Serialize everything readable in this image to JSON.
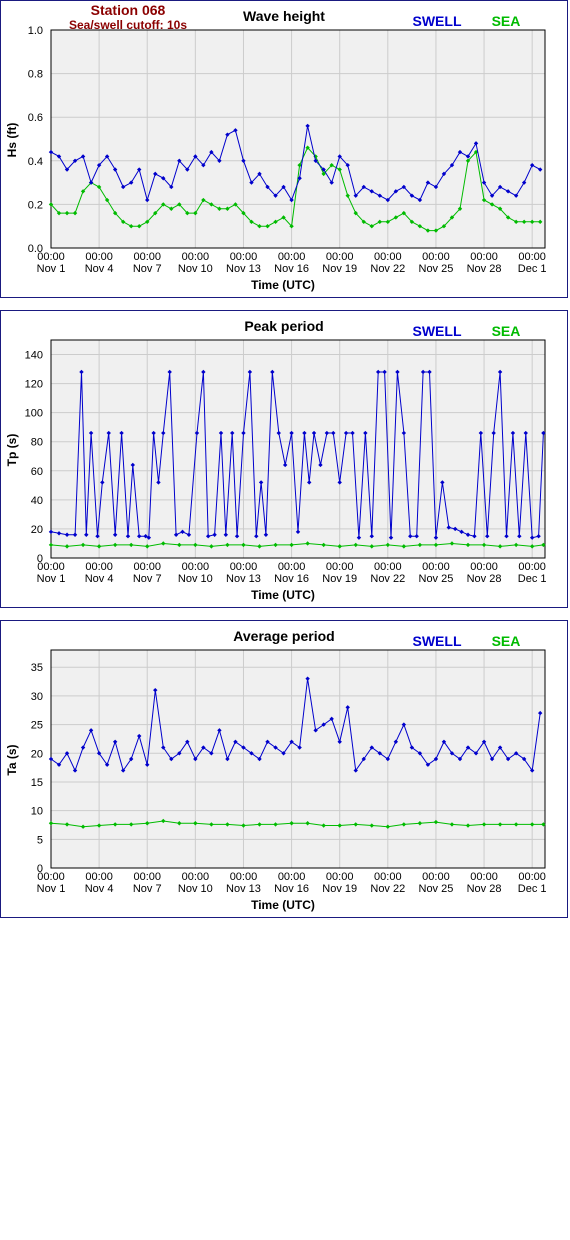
{
  "station": {
    "title": "Station 068",
    "subtitle": "Sea/swell cutoff: 10s"
  },
  "colors": {
    "swell": "#0000cc",
    "sea": "#00bb00",
    "station": "#8b0000",
    "frame": "#1a1a80",
    "plot_bg": "#f0f0f0",
    "grid": "#cccccc"
  },
  "legend": {
    "swell": "SWELL",
    "sea": "SEA"
  },
  "x_ticks": [
    {
      "day": 0,
      "time": "00:00",
      "date": "Nov 1"
    },
    {
      "day": 3,
      "time": "00:00",
      "date": "Nov 4"
    },
    {
      "day": 6,
      "time": "00:00",
      "date": "Nov 7"
    },
    {
      "day": 9,
      "time": "00:00",
      "date": "Nov 10"
    },
    {
      "day": 12,
      "time": "00:00",
      "date": "Nov 13"
    },
    {
      "day": 15,
      "time": "00:00",
      "date": "Nov 16"
    },
    {
      "day": 18,
      "time": "00:00",
      "date": "Nov 19"
    },
    {
      "day": 21,
      "time": "00:00",
      "date": "Nov 22"
    },
    {
      "day": 24,
      "time": "00:00",
      "date": "Nov 25"
    },
    {
      "day": 27,
      "time": "00:00",
      "date": "Nov 28"
    },
    {
      "day": 30,
      "time": "00:00",
      "date": "Dec 1"
    }
  ],
  "chart_data": [
    {
      "type": "line",
      "title": "Wave height",
      "xlabel": "Time (UTC)",
      "ylabel": "Hs (ft)",
      "xlim": [
        0,
        30.8
      ],
      "ylim": [
        0,
        1.0
      ],
      "yticks": [
        "0.0",
        "0.2",
        "0.4",
        "0.6",
        "0.8",
        "1.0"
      ],
      "ytick_values": [
        0,
        0.2,
        0.4,
        0.6,
        0.8,
        1.0
      ],
      "grid": true,
      "legend": "top-right",
      "series": [
        {
          "name": "SWELL",
          "x": [
            0,
            0.5,
            1,
            1.5,
            2,
            2.5,
            3,
            3.5,
            4,
            4.5,
            5,
            5.5,
            6,
            6.5,
            7,
            7.5,
            8,
            8.5,
            9,
            9.5,
            10,
            10.5,
            11,
            11.5,
            12,
            12.5,
            13,
            13.5,
            14,
            14.5,
            15,
            15.5,
            16,
            16.5,
            17,
            17.5,
            18,
            18.5,
            19,
            19.5,
            20,
            20.5,
            21,
            21.5,
            22,
            22.5,
            23,
            23.5,
            24,
            24.5,
            25,
            25.5,
            26,
            26.5,
            27,
            27.5,
            28,
            28.5,
            29,
            29.5,
            30,
            30.5
          ],
          "y": [
            0.44,
            0.42,
            0.36,
            0.4,
            0.42,
            0.3,
            0.38,
            0.42,
            0.36,
            0.28,
            0.3,
            0.36,
            0.22,
            0.34,
            0.32,
            0.28,
            0.4,
            0.36,
            0.42,
            0.38,
            0.44,
            0.4,
            0.52,
            0.54,
            0.4,
            0.3,
            0.34,
            0.28,
            0.24,
            0.28,
            0.22,
            0.32,
            0.56,
            0.4,
            0.36,
            0.3,
            0.42,
            0.38,
            0.24,
            0.28,
            0.26,
            0.24,
            0.22,
            0.26,
            0.28,
            0.24,
            0.22,
            0.3,
            0.28,
            0.34,
            0.38,
            0.44,
            0.42,
            0.48,
            0.3,
            0.24,
            0.28,
            0.26,
            0.24,
            0.3,
            0.38,
            0.36
          ]
        },
        {
          "name": "SEA",
          "x": [
            0,
            0.5,
            1,
            1.5,
            2,
            2.5,
            3,
            3.5,
            4,
            4.5,
            5,
            5.5,
            6,
            6.5,
            7,
            7.5,
            8,
            8.5,
            9,
            9.5,
            10,
            10.5,
            11,
            11.5,
            12,
            12.5,
            13,
            13.5,
            14,
            14.5,
            15,
            15.5,
            16,
            16.5,
            17,
            17.5,
            18,
            18.5,
            19,
            19.5,
            20,
            20.5,
            21,
            21.5,
            22,
            22.5,
            23,
            23.5,
            24,
            24.5,
            25,
            25.5,
            26,
            26.5,
            27,
            27.5,
            28,
            28.5,
            29,
            29.5,
            30,
            30.5
          ],
          "y": [
            0.2,
            0.16,
            0.16,
            0.16,
            0.26,
            0.3,
            0.28,
            0.22,
            0.16,
            0.12,
            0.1,
            0.1,
            0.12,
            0.16,
            0.2,
            0.18,
            0.2,
            0.16,
            0.16,
            0.22,
            0.2,
            0.18,
            0.18,
            0.2,
            0.16,
            0.12,
            0.1,
            0.1,
            0.12,
            0.14,
            0.1,
            0.38,
            0.46,
            0.42,
            0.34,
            0.38,
            0.36,
            0.24,
            0.16,
            0.12,
            0.1,
            0.12,
            0.12,
            0.14,
            0.16,
            0.12,
            0.1,
            0.08,
            0.08,
            0.1,
            0.14,
            0.18,
            0.4,
            0.44,
            0.22,
            0.2,
            0.18,
            0.14,
            0.12,
            0.12,
            0.12,
            0.12
          ]
        }
      ]
    },
    {
      "type": "line",
      "title": "Peak period",
      "xlabel": "Time (UTC)",
      "ylabel": "Tp (s)",
      "xlim": [
        0,
        30.8
      ],
      "ylim": [
        0,
        150
      ],
      "yticks": [
        "0",
        "20",
        "40",
        "60",
        "80",
        "100",
        "120",
        "140"
      ],
      "ytick_values": [
        0,
        20,
        40,
        60,
        80,
        100,
        120,
        140
      ],
      "grid": true,
      "legend": "top-right",
      "series": [
        {
          "name": "SWELL",
          "x": [
            0,
            0.5,
            1,
            1.5,
            1.9,
            2.2,
            2.5,
            2.9,
            3.2,
            3.6,
            4.0,
            4.4,
            4.8,
            5.1,
            5.5,
            5.9,
            6.1,
            6.4,
            6.7,
            7.0,
            7.4,
            7.8,
            8.2,
            8.6,
            9.1,
            9.5,
            9.8,
            10.2,
            10.6,
            10.9,
            11.3,
            11.6,
            12.0,
            12.4,
            12.8,
            13.1,
            13.4,
            13.8,
            14.2,
            14.6,
            15.0,
            15.4,
            15.8,
            16.1,
            16.4,
            16.8,
            17.2,
            17.6,
            18.0,
            18.4,
            18.8,
            19.2,
            19.6,
            20.0,
            20.4,
            20.8,
            21.2,
            21.6,
            22.0,
            22.4,
            22.8,
            23.2,
            23.6,
            24.0,
            24.4,
            24.8,
            25.2,
            25.6,
            26.0,
            26.4,
            26.8,
            27.2,
            27.6,
            28.0,
            28.4,
            28.8,
            29.2,
            29.6,
            30.0,
            30.4,
            30.7
          ],
          "y": [
            18,
            17,
            16,
            16,
            128,
            16,
            86,
            15,
            52,
            86,
            16,
            86,
            15,
            64,
            15,
            15,
            14,
            86,
            52,
            86,
            128,
            16,
            18,
            16,
            86,
            128,
            15,
            16,
            86,
            16,
            86,
            15,
            86,
            128,
            15,
            52,
            16,
            128,
            86,
            64,
            86,
            18,
            86,
            52,
            86,
            64,
            86,
            86,
            52,
            86,
            86,
            14,
            86,
            15,
            128,
            128,
            14,
            128,
            86,
            15,
            15,
            128,
            128,
            14,
            52,
            21,
            20,
            18,
            16,
            15,
            86,
            15,
            86,
            128,
            15,
            86,
            15,
            86,
            14,
            15,
            86
          ]
        },
        {
          "name": "SEA",
          "x": [
            0,
            1,
            2,
            3,
            4,
            5,
            6,
            7,
            8,
            9,
            10,
            11,
            12,
            13,
            14,
            15,
            16,
            17,
            18,
            19,
            20,
            21,
            22,
            23,
            24,
            25,
            26,
            27,
            28,
            29,
            30,
            30.7
          ],
          "y": [
            9,
            8,
            9,
            8,
            9,
            9,
            8,
            10,
            9,
            9,
            8,
            9,
            9,
            8,
            9,
            9,
            10,
            9,
            8,
            9,
            8,
            9,
            8,
            9,
            9,
            10,
            9,
            9,
            8,
            9,
            8,
            9
          ]
        }
      ]
    },
    {
      "type": "line",
      "title": "Average period",
      "xlabel": "Time (UTC)",
      "ylabel": "Ta (s)",
      "xlim": [
        0,
        30.8
      ],
      "ylim": [
        0,
        38
      ],
      "yticks": [
        "0",
        "5",
        "10",
        "15",
        "20",
        "25",
        "30",
        "35"
      ],
      "ytick_values": [
        0,
        5,
        10,
        15,
        20,
        25,
        30,
        35
      ],
      "grid": true,
      "legend": "top-right",
      "series": [
        {
          "name": "SWELL",
          "x": [
            0,
            0.5,
            1,
            1.5,
            2,
            2.5,
            3,
            3.5,
            4,
            4.5,
            5,
            5.5,
            6,
            6.5,
            7,
            7.5,
            8,
            8.5,
            9,
            9.5,
            10,
            10.5,
            11,
            11.5,
            12,
            12.5,
            13,
            13.5,
            14,
            14.5,
            15,
            15.5,
            16,
            16.5,
            17,
            17.5,
            18,
            18.5,
            19,
            19.5,
            20,
            20.5,
            21,
            21.5,
            22,
            22.5,
            23,
            23.5,
            24,
            24.5,
            25,
            25.5,
            26,
            26.5,
            27,
            27.5,
            28,
            28.5,
            29,
            29.5,
            30,
            30.5
          ],
          "y": [
            19,
            18,
            20,
            17,
            21,
            24,
            20,
            18,
            22,
            17,
            19,
            23,
            18,
            31,
            21,
            19,
            20,
            22,
            19,
            21,
            20,
            24,
            19,
            22,
            21,
            20,
            19,
            22,
            21,
            20,
            22,
            21,
            33,
            24,
            25,
            26,
            22,
            28,
            17,
            19,
            21,
            20,
            19,
            22,
            25,
            21,
            20,
            18,
            19,
            22,
            20,
            19,
            21,
            20,
            22,
            19,
            21,
            19,
            20,
            19,
            17,
            27
          ]
        },
        {
          "name": "SEA",
          "x": [
            0,
            1,
            2,
            3,
            4,
            5,
            6,
            7,
            8,
            9,
            10,
            11,
            12,
            13,
            14,
            15,
            16,
            17,
            18,
            19,
            20,
            21,
            22,
            23,
            24,
            25,
            26,
            27,
            28,
            29,
            30,
            30.7
          ],
          "y": [
            7.8,
            7.6,
            7.2,
            7.4,
            7.6,
            7.6,
            7.8,
            8.2,
            7.8,
            7.8,
            7.6,
            7.6,
            7.4,
            7.6,
            7.6,
            7.8,
            7.8,
            7.4,
            7.4,
            7.6,
            7.4,
            7.2,
            7.6,
            7.8,
            8.0,
            7.6,
            7.4,
            7.6,
            7.6,
            7.6,
            7.6,
            7.6
          ]
        }
      ]
    }
  ]
}
